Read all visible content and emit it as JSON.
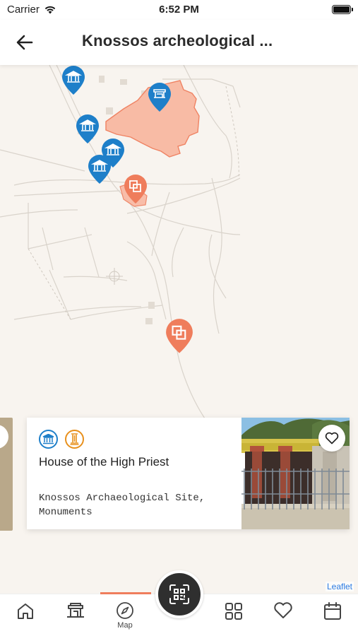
{
  "status_bar": {
    "carrier": "Carrier",
    "time": "6:52 PM"
  },
  "header": {
    "title": "Knossos archeological ...",
    "back_icon": "arrow-left-icon"
  },
  "map": {
    "attribution": "Leaflet",
    "pins": [
      {
        "type": "museum",
        "color": "#1e7fc9"
      },
      {
        "type": "museum",
        "color": "#1e7fc9"
      },
      {
        "type": "museum",
        "color": "#1e7fc9"
      },
      {
        "type": "museum",
        "color": "#1e7fc9"
      },
      {
        "type": "site",
        "color": "#1e7fc9"
      },
      {
        "type": "monument",
        "color": "#ef7d5c"
      },
      {
        "type": "monument",
        "color": "#ef7d5c"
      }
    ]
  },
  "card": {
    "title": "House of the High Priest",
    "subtitle": "Knossos Archaeological Site, Monuments",
    "icons": [
      {
        "name": "museum-icon",
        "color": "#1e7fc9"
      },
      {
        "name": "column-icon",
        "color": "#e8901c"
      }
    ],
    "favorite_icon": "heart-icon"
  },
  "tabbar": {
    "tabs": [
      {
        "name": "home",
        "label": ""
      },
      {
        "name": "sites",
        "label": ""
      },
      {
        "name": "map",
        "label": "Map"
      },
      {
        "name": "categories",
        "label": ""
      },
      {
        "name": "favorites",
        "label": ""
      },
      {
        "name": "calendar",
        "label": ""
      }
    ],
    "active_color": "#ef7d5c",
    "scan_button_icon": "qr-scan-icon"
  }
}
